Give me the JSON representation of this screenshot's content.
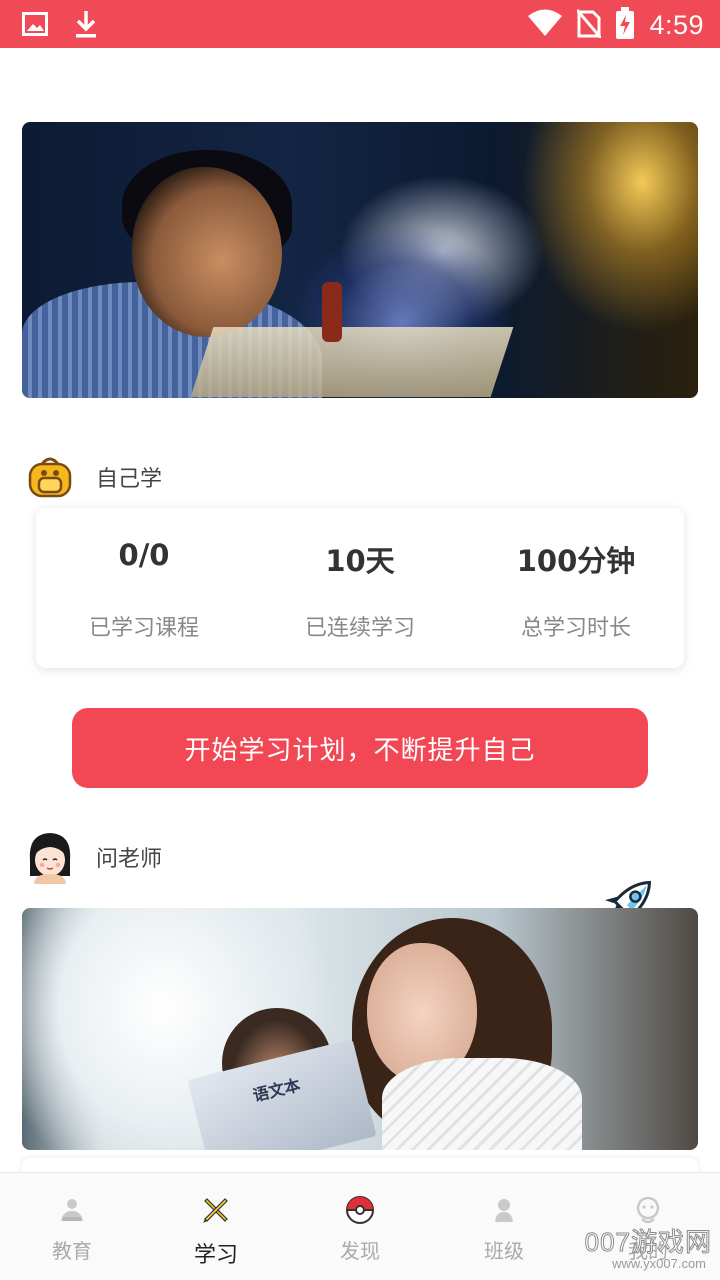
{
  "status_bar": {
    "time": "4:59",
    "icons": [
      "image-icon",
      "download-icon",
      "wifi-icon",
      "no-sim-icon",
      "battery-charging-icon"
    ]
  },
  "self_study": {
    "title": "自己学",
    "icon": "schoolbag-icon",
    "stats": [
      {
        "value": "0/0",
        "caption": "已学习课程"
      },
      {
        "value": "10天",
        "caption": "已连续学习"
      },
      {
        "value": "100分钟",
        "caption": "总学习时长"
      }
    ]
  },
  "cta": {
    "label": "开始学习计划，不断提升自己"
  },
  "ask_teacher": {
    "title": "问老师",
    "icon": "teacher-avatar-icon",
    "textbook_title": "语文本"
  },
  "bottom_nav": {
    "items": [
      {
        "label": "教育",
        "icon": "education-icon",
        "active": false
      },
      {
        "label": "学习",
        "icon": "pencil-ruler-icon",
        "active": true
      },
      {
        "label": "发现",
        "icon": "pokeball-icon",
        "active": false
      },
      {
        "label": "班级",
        "icon": "class-icon",
        "active": false
      },
      {
        "label": "我的",
        "icon": "profile-icon",
        "active": false
      }
    ]
  },
  "watermark": {
    "text": "007游戏网",
    "url": "www.yx007.com"
  },
  "colors": {
    "accent": "#f24755",
    "status_bar": "#f04a57"
  }
}
